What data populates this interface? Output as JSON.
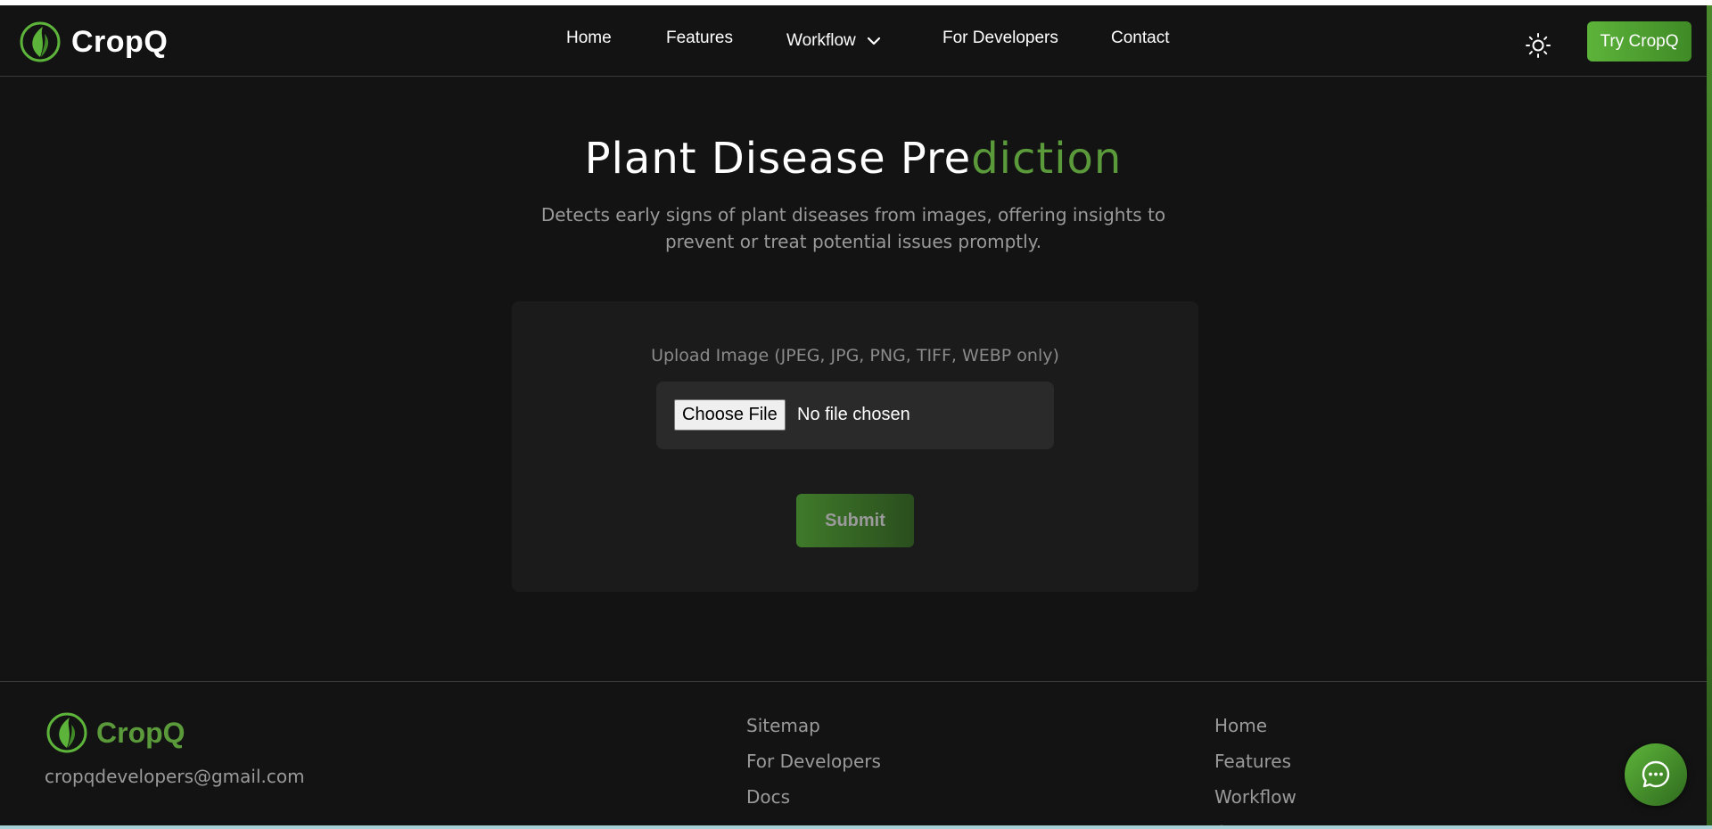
{
  "brand": {
    "name": "CropQ"
  },
  "nav": {
    "items": [
      {
        "label": "Home"
      },
      {
        "label": "Features"
      },
      {
        "label": "Workflow"
      },
      {
        "label": "For Developers"
      },
      {
        "label": "Contact"
      }
    ],
    "cta_label": "Try CropQ",
    "theme_icon": "sun-icon",
    "workflow_icon": "chevron-down-icon"
  },
  "hero": {
    "title_main": "Plant Disease Pre",
    "title_accent": "diction",
    "subtitle": "Detects early signs of plant diseases from images, offering insights to prevent or treat potential issues promptly."
  },
  "upload": {
    "label": "Upload Image (JPEG, JPG, PNG, TIFF, WEBP only)",
    "choose_label": "Choose File",
    "status": "No file chosen",
    "submit_label": "Submit"
  },
  "footer": {
    "brand_name": "CropQ",
    "email": "cropqdevelopers@gmail.com",
    "col1": [
      {
        "label": "Sitemap"
      },
      {
        "label": "For Developers"
      },
      {
        "label": "Docs"
      }
    ],
    "col2": [
      {
        "label": "Home"
      },
      {
        "label": "Features"
      },
      {
        "label": "Workflow"
      },
      {
        "label": "Contact"
      }
    ]
  },
  "chat": {
    "icon": "chat-bubble-icon"
  },
  "colors": {
    "background": "#131313",
    "accent_green": "#5db43a",
    "accent_dark_green": "#3f7a2a",
    "muted_text": "#9a9a9a"
  }
}
